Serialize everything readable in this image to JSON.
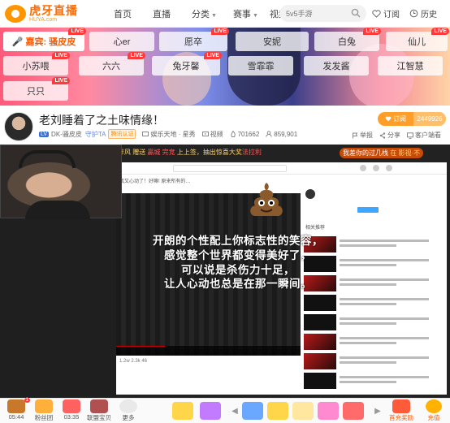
{
  "header": {
    "logo_cn": "虎牙直播",
    "logo_en": "HUYA.com",
    "nav": [
      "首页",
      "直播",
      "分类",
      "赛事",
      "视频"
    ],
    "search_placeholder": "5v5手游",
    "subscribe": "订阅",
    "history": "历史"
  },
  "guests": {
    "live_badge": "LIVE",
    "items": [
      {
        "label": "嘉宾: 骚皮皮",
        "live": true
      },
      {
        "label": "心er",
        "live": false
      },
      {
        "label": "愿卒",
        "live": true
      },
      {
        "label": "安妮",
        "live": false
      },
      {
        "label": "白兔",
        "live": true
      },
      {
        "label": "仙儿",
        "live": true
      },
      {
        "label": "小苏喂",
        "live": true
      },
      {
        "label": "六六",
        "live": true
      },
      {
        "label": "兔牙馨",
        "live": true
      },
      {
        "label": "雪霏霏",
        "live": false
      },
      {
        "label": "发发酱",
        "live": false
      },
      {
        "label": "江智慧",
        "live": false
      },
      {
        "label": "只只",
        "live": true
      }
    ]
  },
  "room": {
    "title": "老刘睡着了之土味情缘！",
    "level": "LV",
    "streamer": "DK-骚皮皮",
    "guard": "守护TA",
    "certified": "腾讯认证",
    "category": "娱乐天地 · 星秀",
    "type": "视频",
    "popularity": "701662",
    "fans": "859,901",
    "subscribe_label": "订阅",
    "subscribe_count": "2449926",
    "report": "举报",
    "share": "分享",
    "client": "客户端看"
  },
  "video": {
    "banner_left_prefix": "元气伴风",
    "banner_left": "赠送",
    "banner_left_user": "贏城 完竞",
    "banner_left_rest": "上上签，抽出惊喜大奖",
    "banner_left_tail": "法拉利",
    "banner_right": "我差你的过几栈",
    "banner_right_tail": "在 影视·不",
    "caption_lines": [
      "开朗的个性配上你标志性的笑容，",
      "感觉整个世界都变得美好了，",
      "可以说是杀伤力十足，",
      "让人心动也总是在那一瞬间。"
    ],
    "yt_title": "我又心动了！好嘛! 原来所有的…",
    "related_label": "相关推荐",
    "footer_left": "1.2w 2.3k 46"
  },
  "bottom": {
    "items": [
      {
        "label": "05:44",
        "icon": "treasure-chest-icon",
        "badge": "1"
      },
      {
        "label": "粉丝团",
        "icon": "fan-club-icon",
        "badge": ""
      },
      {
        "label": "03:35",
        "icon": "gift-box-icon",
        "badge": ""
      },
      {
        "label": "联盟宝贝",
        "icon": "alliance-icon",
        "badge": ""
      },
      {
        "label": "更多",
        "icon": "more-icon",
        "badge": ""
      }
    ],
    "first_charge": "首充奖励",
    "recharge": "充值"
  },
  "colors": {
    "accent": "#ff9600",
    "live_red": "#ff3a3a",
    "subscribe": "#ff9f2a"
  }
}
